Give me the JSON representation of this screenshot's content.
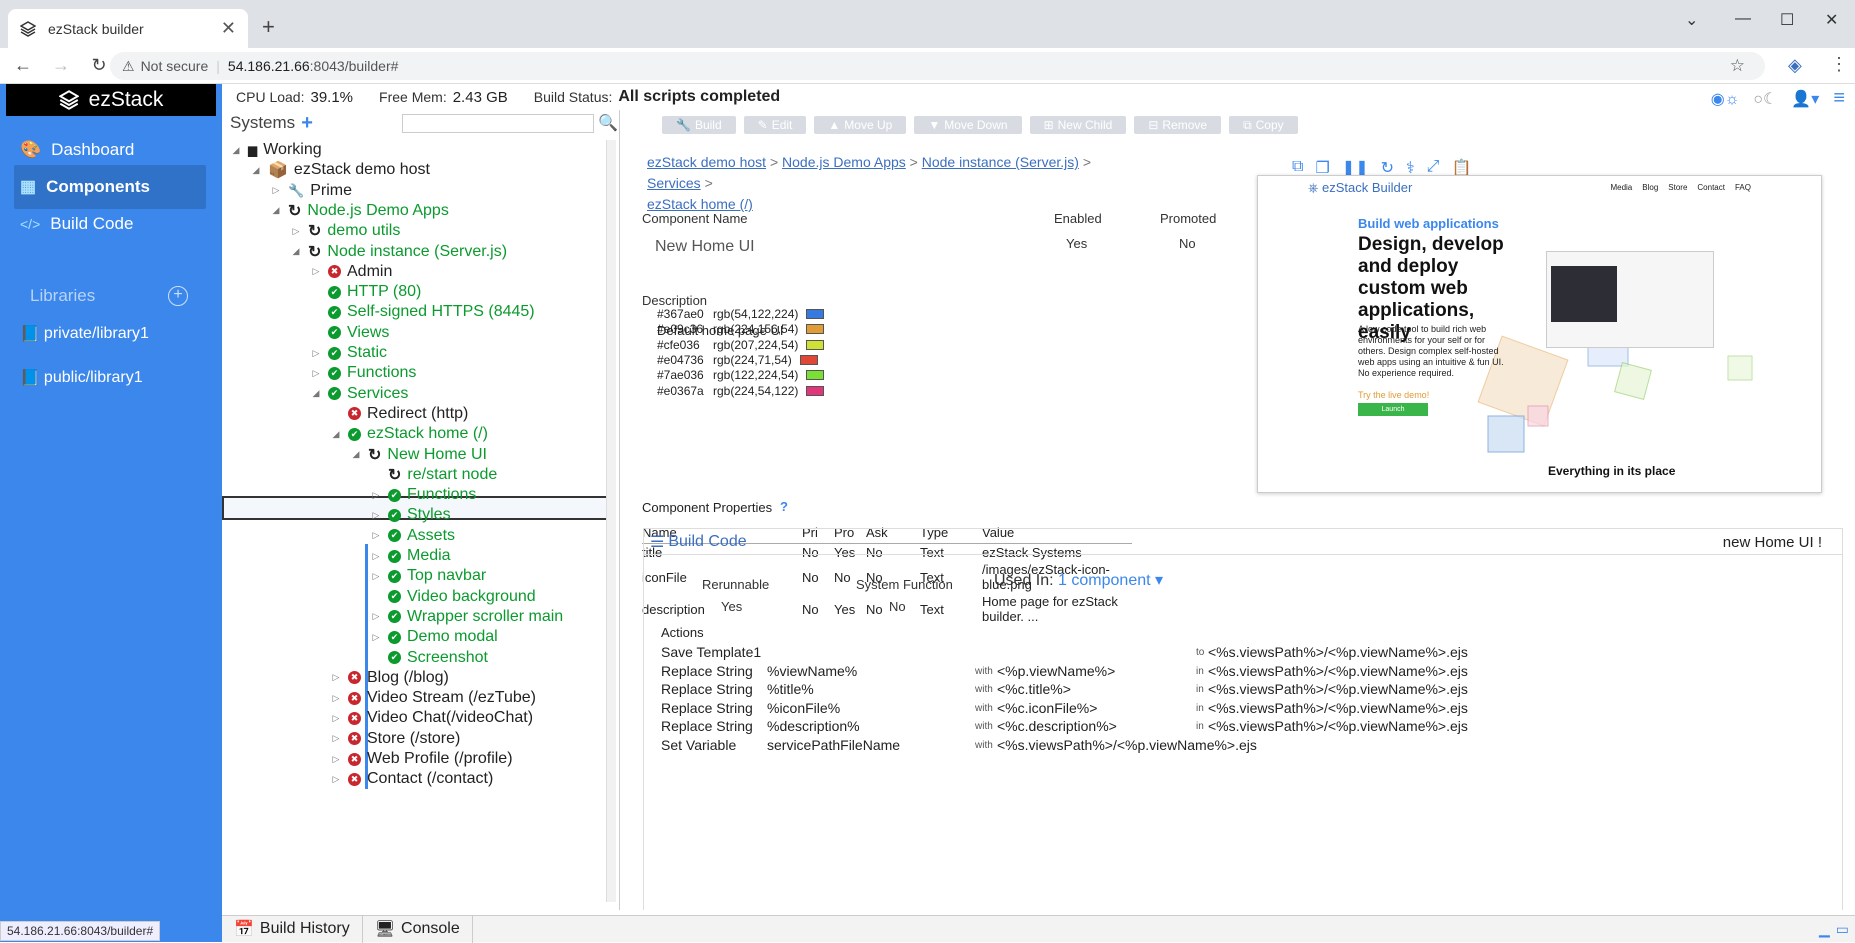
{
  "browser": {
    "tab_title": "ezStack builder",
    "security_label": "Not secure",
    "url_host": "54.186.21.66",
    "url_rest": ":8043/builder#"
  },
  "sidebar": {
    "logo": "ezStack",
    "items": [
      {
        "label": "Dashboard"
      },
      {
        "label": "Components"
      },
      {
        "label": "Build Code"
      }
    ],
    "libraries_label": "Libraries",
    "libraries": [
      {
        "label": "private/library1"
      },
      {
        "label": "public/library1"
      }
    ],
    "status_url": "54.186.21.66:8043/builder#"
  },
  "topbar": {
    "cpu_label": "CPU Load:",
    "cpu_value": "39.1%",
    "mem_label": "Free Mem:",
    "mem_value": "2.43 GB",
    "build_label": "Build Status:",
    "build_value": "All scripts completed"
  },
  "tree": {
    "title": "Systems",
    "nodes": [
      {
        "label": "Working"
      },
      {
        "label": "ezStack demo host"
      },
      {
        "label": "Prime"
      },
      {
        "label": "Node.js Demo Apps"
      },
      {
        "label": "demo utils"
      },
      {
        "label": "Node instance (Server.js)"
      },
      {
        "label": "Admin"
      },
      {
        "label": "HTTP (80)"
      },
      {
        "label": "Self-signed HTTPS (8445)"
      },
      {
        "label": "Views"
      },
      {
        "label": "Static"
      },
      {
        "label": "Functions"
      },
      {
        "label": "Services"
      },
      {
        "label": "Redirect (http)"
      },
      {
        "label": "ezStack home (/)"
      },
      {
        "label": "New Home UI"
      },
      {
        "label": "re/start node"
      },
      {
        "label": "Functions"
      },
      {
        "label": "Styles"
      },
      {
        "label": "Assets"
      },
      {
        "label": "Media"
      },
      {
        "label": "Top navbar"
      },
      {
        "label": "Video background"
      },
      {
        "label": "Wrapper scroller main"
      },
      {
        "label": "Demo modal"
      },
      {
        "label": "Screenshot"
      },
      {
        "label": "Blog (/blog)"
      },
      {
        "label": "Video Stream (/ezTube)"
      },
      {
        "label": "Video Chat(/videoChat)"
      },
      {
        "label": "Store (/store)"
      },
      {
        "label": "Web Profile (/profile)"
      },
      {
        "label": "Contact (/contact)"
      }
    ]
  },
  "toolbar": {
    "buttons": [
      {
        "label": "Build"
      },
      {
        "label": "Edit"
      },
      {
        "label": "Move Up"
      },
      {
        "label": "Move Down"
      },
      {
        "label": "New Child"
      },
      {
        "label": "Remove"
      },
      {
        "label": "Copy"
      }
    ]
  },
  "breadcrumb": {
    "items": [
      "ezStack demo host",
      "Node.js Demo Apps",
      "Node instance (Server.js)",
      "Services",
      "ezStack home (/)"
    ],
    "sep": ">"
  },
  "component": {
    "name_label": "Component Name",
    "name_value": "New Home UI",
    "enabled_label": "Enabled",
    "enabled_value": "Yes",
    "promoted_label": "Promoted",
    "promoted_value": "No",
    "description_label": "Description",
    "description_value": "Default home page UI",
    "colors": [
      {
        "hex": "#367ae0",
        "rgb": "rgb(54,122,224)"
      },
      {
        "hex": "#e09c36",
        "rgb": "rgb(224,156,54)"
      },
      {
        "hex": "#cfe036",
        "rgb": "rgb(207,224,54)"
      },
      {
        "hex": "#e04736",
        "rgb": "rgb(224,71,54)"
      },
      {
        "hex": "#7ae036",
        "rgb": "rgb(122,224,54)"
      },
      {
        "hex": "#e0367a",
        "rgb": "rgb(224,54,122)"
      }
    ]
  },
  "properties": {
    "title": "Component Properties",
    "columns": [
      "Name",
      "Pri",
      "Pro",
      "Ask",
      "Type",
      "Value"
    ],
    "rows": [
      [
        "title",
        "No",
        "Yes",
        "No",
        "Text",
        "ezStack Systems"
      ],
      [
        "iconFile",
        "No",
        "No",
        "No",
        "Text",
        "/images/ezStack-icon-blue.png"
      ],
      [
        "description",
        "No",
        "Yes",
        "No",
        "Text",
        "Home page for ezStack builder. ..."
      ]
    ]
  },
  "preview": {
    "brand": "ezStack Builder",
    "nav": [
      "Media",
      "Blog",
      "Store",
      "Contact",
      "FAQ"
    ],
    "subtitle": "Build web applications",
    "headline": "Design, develop and deploy custom web applications, easily",
    "body": "A low code tool to build rich web environments for your self or for others. Design complex self-hosted web apps using an intuitive & fun UI. No experience required.",
    "try": "Try the live demo!",
    "launch": "Launch",
    "footer": "Everything in its place"
  },
  "build_code": {
    "title": "Build Code",
    "right_title": "new Home UI !",
    "rerunnable_label": "Rerunnable",
    "rerunnable_value": "Yes",
    "sysfunc_label": "System Function",
    "sysfunc_value": "No",
    "used_in_label": "Used In:",
    "used_in_link": "1 component",
    "actions_label": "Actions",
    "actions": [
      {
        "action": "Save Template1",
        "arg": "",
        "with": "",
        "target_kw": "to",
        "target": "<%s.viewsPath%>/<%p.viewName%>.ejs"
      },
      {
        "action": "Replace String",
        "arg": "%viewName%",
        "with": "<%p.viewName%>",
        "target_kw": "in",
        "target": "<%s.viewsPath%>/<%p.viewName%>.ejs"
      },
      {
        "action": "Replace String",
        "arg": "%title%",
        "with": "<%c.title%>",
        "target_kw": "in",
        "target": "<%s.viewsPath%>/<%p.viewName%>.ejs"
      },
      {
        "action": "Replace String",
        "arg": "%iconFile%",
        "with": "<%c.iconFile%>",
        "target_kw": "in",
        "target": "<%s.viewsPath%>/<%p.viewName%>.ejs"
      },
      {
        "action": "Replace String",
        "arg": "%description%",
        "with": "<%c.description%>",
        "target_kw": "in",
        "target": "<%s.viewsPath%>/<%p.viewName%>.ejs"
      },
      {
        "action": "Set Variable",
        "arg": "servicePathFileName",
        "with": "<%s.viewsPath%>/<%p.viewName%>.ejs",
        "target_kw": "",
        "target": ""
      }
    ],
    "with_kw": "with"
  },
  "bottom": {
    "tabs": [
      {
        "label": "Build History"
      },
      {
        "label": "Console"
      }
    ]
  }
}
